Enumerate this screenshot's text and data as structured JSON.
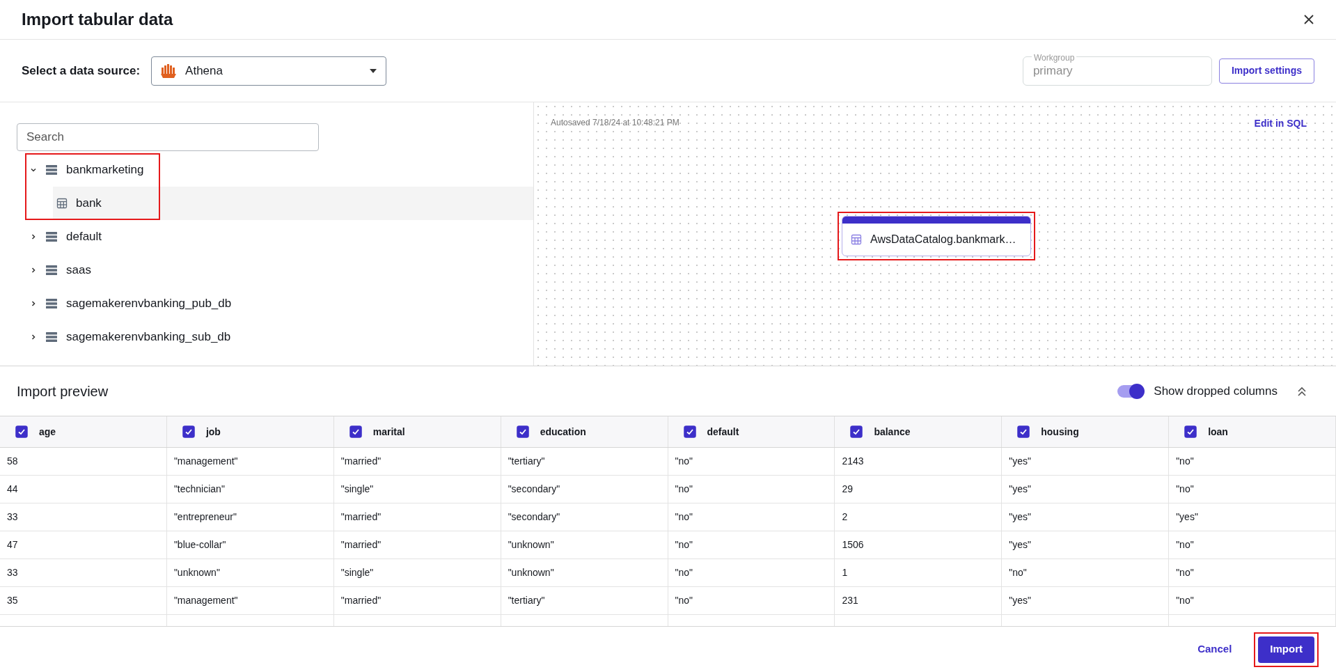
{
  "dialog": {
    "title": "Import tabular data"
  },
  "source": {
    "label": "Select a data source:",
    "value": "Athena"
  },
  "workgroup": {
    "label": "Workgroup",
    "value": "primary"
  },
  "import_settings": "Import settings",
  "search": {
    "placeholder": "Search"
  },
  "tree": [
    {
      "label": "bankmarketing",
      "expanded": true,
      "highlighted": true,
      "children": [
        {
          "label": "bank",
          "selected": true
        }
      ]
    },
    {
      "label": "default",
      "expanded": false,
      "highlighted": false
    },
    {
      "label": "saas",
      "expanded": false,
      "highlighted": false
    },
    {
      "label": "sagemakerenvbanking_pub_db",
      "expanded": false,
      "highlighted": false
    },
    {
      "label": "sagemakerenvbanking_sub_db",
      "expanded": false,
      "highlighted": false
    }
  ],
  "canvas": {
    "autosaved": "Autosaved 7/18/24 at 10:48:21 PM",
    "edit_link": "Edit in SQL",
    "node": {
      "label": "AwsDataCatalog.bankmark…",
      "highlighted": true
    }
  },
  "preview": {
    "title": "Import preview",
    "toggle": {
      "label": "Show dropped columns",
      "on": true
    },
    "columns": [
      {
        "name": "age",
        "checked": true
      },
      {
        "name": "job",
        "checked": true
      },
      {
        "name": "marital",
        "checked": true
      },
      {
        "name": "education",
        "checked": true
      },
      {
        "name": "default",
        "checked": true
      },
      {
        "name": "balance",
        "checked": true
      },
      {
        "name": "housing",
        "checked": true
      },
      {
        "name": "loan",
        "checked": true
      }
    ],
    "rows": [
      [
        "58",
        "\"management\"",
        "\"married\"",
        "\"tertiary\"",
        "\"no\"",
        "2143",
        "\"yes\"",
        "\"no\""
      ],
      [
        "44",
        "\"technician\"",
        "\"single\"",
        "\"secondary\"",
        "\"no\"",
        "29",
        "\"yes\"",
        "\"no\""
      ],
      [
        "33",
        "\"entrepreneur\"",
        "\"married\"",
        "\"secondary\"",
        "\"no\"",
        "2",
        "\"yes\"",
        "\"yes\""
      ],
      [
        "47",
        "\"blue-collar\"",
        "\"married\"",
        "\"unknown\"",
        "\"no\"",
        "1506",
        "\"yes\"",
        "\"no\""
      ],
      [
        "33",
        "\"unknown\"",
        "\"single\"",
        "\"unknown\"",
        "\"no\"",
        "1",
        "\"no\"",
        "\"no\""
      ],
      [
        "35",
        "\"management\"",
        "\"married\"",
        "\"tertiary\"",
        "\"no\"",
        "231",
        "\"yes\"",
        "\"no\""
      ]
    ]
  },
  "footer": {
    "cancel": "Cancel",
    "import": {
      "label": "Import",
      "highlighted": true
    }
  }
}
